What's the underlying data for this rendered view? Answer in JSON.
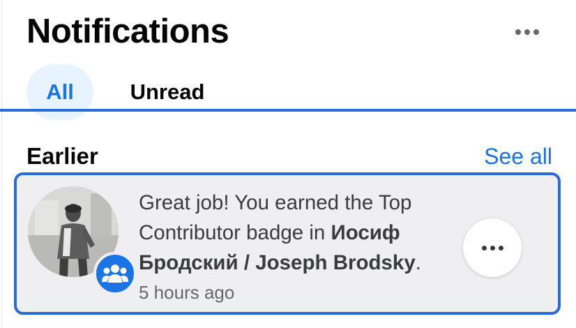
{
  "header": {
    "title": "Notifications",
    "menu_icon": "more-horizontal-icon"
  },
  "tabs": [
    {
      "label": "All",
      "selected": true
    },
    {
      "label": "Unread",
      "selected": false
    }
  ],
  "section": {
    "title": "Earlier",
    "see_all": "See all"
  },
  "notification": {
    "text_before": "Great job! You earned the Top Contributor badge in ",
    "group_name": "Иосиф Бродский / Joseph Brodsky",
    "text_after": ".",
    "time": "5 hours ago",
    "badge_icon": "group-icon",
    "menu_icon": "more-horizontal-icon"
  },
  "colors": {
    "accent": "#1b74e4",
    "tab_selected_bg": "#e7f3ff",
    "card_bg": "#efeff1",
    "card_border": "#2a6bdc"
  }
}
